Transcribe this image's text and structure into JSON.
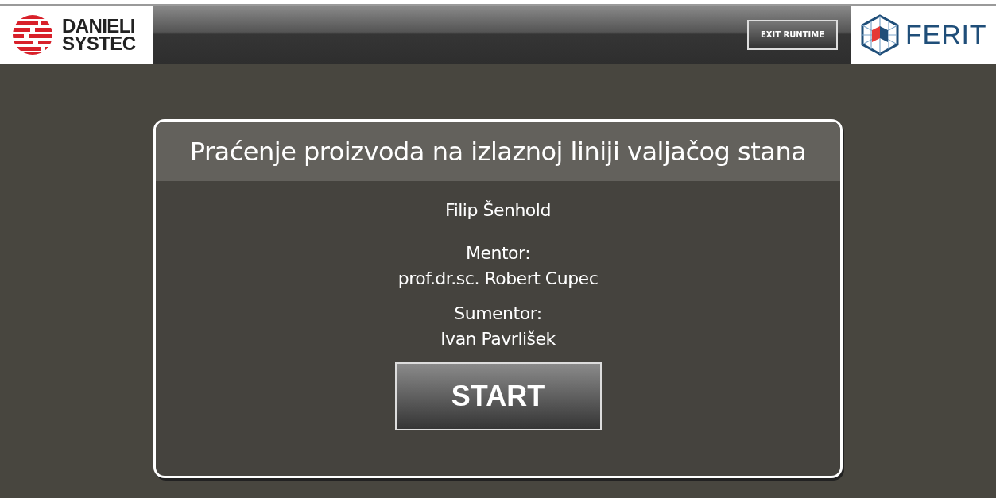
{
  "header": {
    "left_logo": [
      "DANIELI",
      "SYSTEC"
    ],
    "exit_button": "EXIT RUNTIME",
    "right_logo": "FERIT"
  },
  "card": {
    "title": "Praćenje proizvoda na izlaznoj liniji valjačog stana",
    "author": "Filip Šenhold",
    "mentor_label": "Mentor:",
    "mentor": "prof.dr.sc. Robert Cupec",
    "co_mentor_label": "Sumentor:",
    "co_mentor": "Ivan Pavrlišek",
    "start_button": "START"
  }
}
